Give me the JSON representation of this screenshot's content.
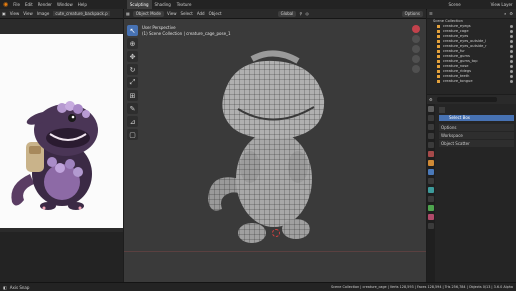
{
  "topbar": {
    "menus": [
      "File",
      "Edit",
      "Render",
      "Window",
      "Help"
    ],
    "workspace_tabs": [
      "Sculpting",
      "Shading",
      "Texture"
    ],
    "scene_label": "Scene",
    "view_layer_label": "View Layer"
  },
  "image_editor": {
    "header_items": [
      "View",
      "View",
      "Image"
    ],
    "image_name": "cute_creature_backpack.p"
  },
  "viewport": {
    "mode": "Object Mode",
    "menus": [
      "View",
      "Select",
      "Add",
      "Object"
    ],
    "transform": "Global",
    "options": "Options",
    "overlay_title": "User Perspective",
    "overlay_sub": "(1) Scene Collection | creature_cage_pose_1",
    "tools": [
      "select",
      "cursor",
      "move",
      "rotate",
      "scale",
      "transform",
      "annotate",
      "measure",
      "add-cube"
    ]
  },
  "outliner": {
    "title": "Scene Collection",
    "items": [
      "creature_eyegs",
      "creature_cage",
      "creature_eyes",
      "creature_eyes_outside_l",
      "creature_eyes_outside_r",
      "creature_fur",
      "creature_gums",
      "creature_gums_top",
      "creature_nose",
      "creature_ridegs",
      "creature_teeth",
      "creature_tongue"
    ]
  },
  "properties": {
    "active_tool": "Select Box",
    "panels": [
      "Options",
      "Workspace",
      "Object Scatter"
    ]
  },
  "statusbar": {
    "left": "Axis Snap",
    "right": "Scene Collection | creature_cage | Verts 128,593 | Faces 128,594 | Tris 256,784 | Objects 0/13 | 3.6.0 Alpha"
  },
  "badge": "A",
  "colors": {
    "accent": "#4772b3",
    "orange": "#e4a23c"
  }
}
